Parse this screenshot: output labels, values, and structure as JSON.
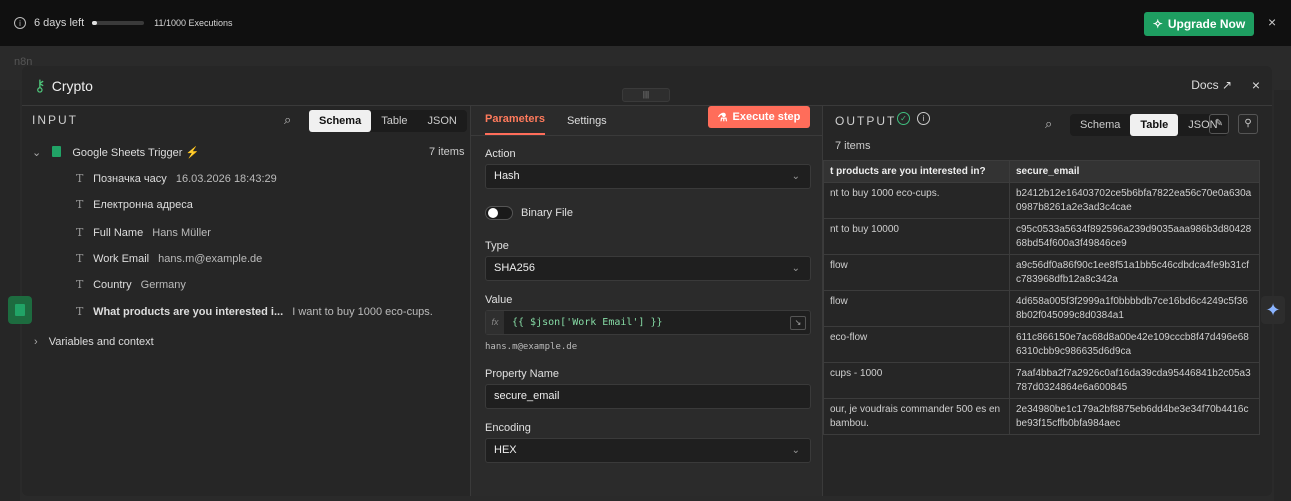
{
  "topbar": {
    "days_left": "6 days left",
    "trial_progress_percent": 10,
    "executions": "11/1000 Executions",
    "upgrade_label": "Upgrade Now",
    "close": "×"
  },
  "background": {
    "faint_text": "n8n"
  },
  "modal": {
    "title": "Crypto",
    "docs_label": "Docs ↗",
    "close": "×",
    "grip": "|||"
  },
  "input": {
    "label": "INPUT",
    "views": [
      "Schema",
      "Table",
      "JSON"
    ],
    "active_view": "Schema",
    "trigger_name": "Google Sheets Trigger",
    "items_count": "7 items",
    "fields": [
      {
        "name": "Позначка часу",
        "value": "16.03.2026 18:43:29"
      },
      {
        "name": "Електронна адреса",
        "value": ""
      },
      {
        "name": "Full Name",
        "value": "Hans Müller"
      },
      {
        "name": "Work Email",
        "value": "hans.m@example.de"
      },
      {
        "name": "Country",
        "value": "Germany"
      },
      {
        "name": "What products are you interested i...",
        "value": "I want to buy 1000 eco-cups."
      }
    ],
    "variables_label": "Variables and context"
  },
  "parameters": {
    "tabs": [
      "Parameters",
      "Settings"
    ],
    "active_tab": "Parameters",
    "execute_label": "Execute step",
    "action_label": "Action",
    "action_value": "Hash",
    "binary_label": "Binary File",
    "type_label": "Type",
    "type_value": "SHA256",
    "value_label": "Value",
    "value_expression": "{{ $json['Work Email'] }}",
    "value_preview": "hans.m@example.de",
    "property_label": "Property Name",
    "property_value": "secure_email",
    "encoding_label": "Encoding",
    "encoding_value": "HEX"
  },
  "output": {
    "label": "OUTPUT",
    "items_count": "7 items",
    "views": [
      "Schema",
      "Table",
      "JSON"
    ],
    "active_view": "Table",
    "columns": [
      "t products are you interested in?",
      "secure_email"
    ],
    "rows": [
      [
        "nt to buy 1000 eco-cups.",
        "b2412b12e16403702ce5b6bfa7822ea56c70e0a630a0987b8261a2e3ad3c4cae"
      ],
      [
        "nt to buy 10000",
        "c95c0533a5634f892596a239d9035aaa986b3d8042868bd54f600a3f49846ce9"
      ],
      [
        "flow",
        "a9c56df0a86f90c1ee8f51a1bb5c46cdbdca4fe9b31cfc783968dfb12a8c342a"
      ],
      [
        "flow",
        "4d658a005f3f2999a1f0bbbbdb7ce16bd6c4249c5f368b02f045099c8d0384a1"
      ],
      [
        "eco-flow",
        "611c866150e7ac68d8a00e42e109cccb8f47d496e686310cbb9c986635d6d9ca"
      ],
      [
        "cups - 1000",
        "7aaf4bba2f7a2926c0af16da39cda95446841b2c05a3787d0324864e6a600845"
      ],
      [
        "our, je voudrais commander 500 es en bambou.",
        "2e34980be1c179a2bf8875eb6dd4be3e34f70b4416cbe93f15cffb0bfa984aec"
      ]
    ]
  },
  "colors": {
    "accent": "#ff6d5a",
    "upgrade": "#1e9e61",
    "success": "#3fbf7f"
  }
}
